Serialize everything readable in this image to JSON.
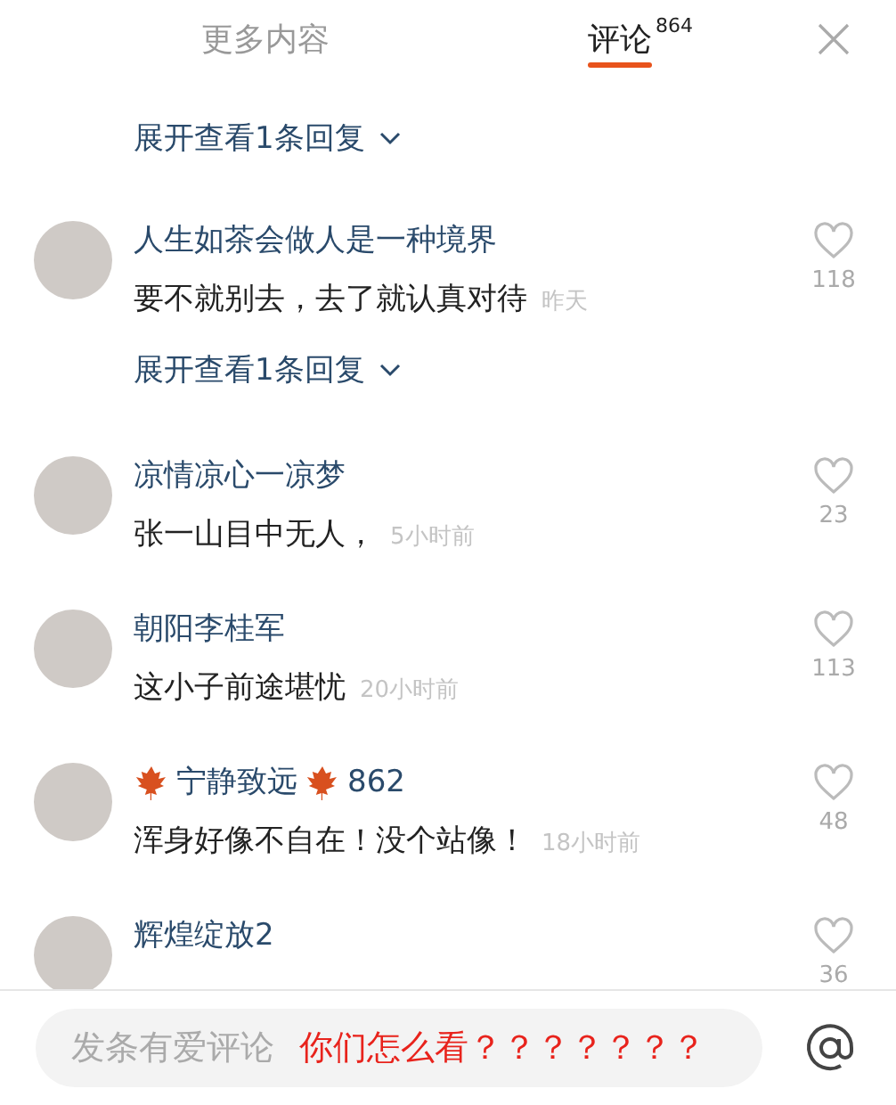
{
  "tabs": [
    {
      "label": "更多内容",
      "selected": false
    },
    {
      "label": "评论",
      "badge": "864",
      "selected": true
    }
  ],
  "top_reply_link": "展开查看1条回复",
  "comments": [
    {
      "name_segments": [
        {
          "kind": "text",
          "text": "人生如茶会做人是一种境界"
        }
      ],
      "text": "要不就别去，去了就认真对待",
      "time": "昨天",
      "likes": "118",
      "reply_link": "展开查看1条回复"
    },
    {
      "name_segments": [
        {
          "kind": "text",
          "text": "凉情凉心一凉梦"
        }
      ],
      "text": "张一山目中无人，",
      "time": "5小时前",
      "likes": "23"
    },
    {
      "name_segments": [
        {
          "kind": "text",
          "text": "朝阳李桂军"
        }
      ],
      "text": "这小子前途堪忧",
      "time": "20小时前",
      "likes": "113"
    },
    {
      "name_segments": [
        {
          "kind": "leaf"
        },
        {
          "kind": "text",
          "text": "宁静致远"
        },
        {
          "kind": "leaf"
        },
        {
          "kind": "text",
          "text": "862"
        }
      ],
      "text": "浑身好像不自在！没个站像！",
      "time": "18小时前",
      "likes": "48"
    },
    {
      "name_segments": [
        {
          "kind": "text",
          "text": "辉煌绽放2"
        }
      ],
      "likes": "36"
    }
  ],
  "composer": {
    "placeholder": "发条有爱评论",
    "annotation": "你们怎么看？？？？？？？"
  }
}
